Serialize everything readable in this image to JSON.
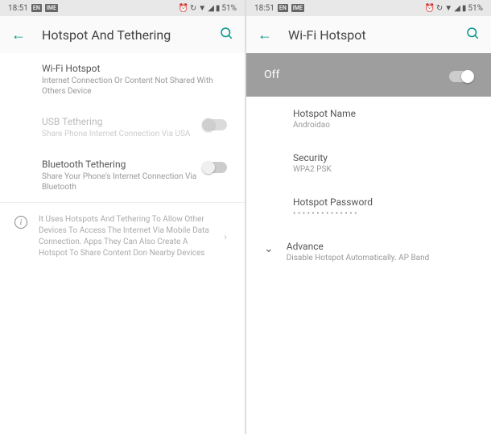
{
  "status": {
    "time": "18:51",
    "badge1": "EN",
    "badge2": "IME",
    "battery": "51%"
  },
  "left": {
    "title": "Hotspot And Tethering",
    "items": {
      "wifi": {
        "title": "Wi-Fi Hotspot",
        "sub": "Internet Connection Or Content Not Shared With Others Device"
      },
      "usb": {
        "title": "USB Tethering",
        "sub": "Share Phone Internet Connection Via USA"
      },
      "bt": {
        "title": "Bluetooth Tethering",
        "sub": "Share Your Phone's Internet Connection Via Bluetooth"
      }
    },
    "info": "It Uses Hotspots And Tethering To Allow Other Devices To Access The Internet Via Mobile Data Connection. Apps They Can Also Create A Hotspot To Share Content Don Nearby Devices"
  },
  "right": {
    "title": "Wi-Fi Hotspot",
    "toggle_label": "Off",
    "hotspot_name": {
      "label": "Hotspot Name",
      "value": "Androidao"
    },
    "security": {
      "label": "Security",
      "value": "WPA2 PSK"
    },
    "password": {
      "label": "Hotspot Password",
      "value": "• • • • • • • • • • • • • •"
    },
    "advance": {
      "label": "Advance",
      "value": "Disable Hotspot Automatically. AP Band"
    }
  }
}
